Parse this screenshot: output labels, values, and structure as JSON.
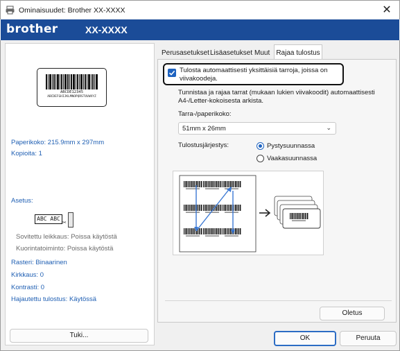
{
  "window": {
    "title": "Ominaisuudet: Brother XX-XXXX"
  },
  "brand": {
    "logo": "brother",
    "model": "XX-XXXX"
  },
  "left_panel": {
    "preview": {
      "code_text": "ABCDE12345",
      "code_sub": "ABCDEFGHIJKLMNOPQRSTUVWXYZ"
    },
    "paper_size": "Paperikoko: 215.9mm x 297mm",
    "copies": "Kopioita: 1",
    "layout": "Asetus:",
    "cut_illustration_text": "ABC ABC",
    "smart_cut": "Sovitettu leikkaus: Poissa käytöstä",
    "chain_print": "Kuorintatoiminto: Poissa käytöstä",
    "halftone": "Rasteri: Binaarinen",
    "brightness": "Kirkkaus:    0",
    "contrast": "Kontrasti:    0",
    "distributed_print": "Hajautettu tulostus: Käytössä",
    "support_button": "Tuki..."
  },
  "tabs": [
    {
      "label": "Perusasetukset"
    },
    {
      "label": "Lisäasetukset"
    },
    {
      "label": "Muut"
    },
    {
      "label": "Rajaa tulostus"
    }
  ],
  "crop_print": {
    "checkbox_label": "Tulosta automaattisesti yksittäisiä tarroja, joissa on viivakoodeja.",
    "checkbox_checked": true,
    "description": "Tunnistaa ja rajaa tarrat (mukaan lukien viivakoodit) automaattisesti A4-/Letter-kokoisesta arkista.",
    "size_label": "Tarra-/paperikoko:",
    "size_value": "51mm x 26mm",
    "order_label": "Tulostusjärjestys:",
    "order_options": [
      {
        "label": "Pystysuunnassa",
        "selected": true
      },
      {
        "label": "Vaakasuunnassa",
        "selected": false
      }
    ],
    "defaults_button": "Oletus"
  },
  "footer": {
    "ok_button": "OK",
    "cancel_button": "Peruuta"
  },
  "colors": {
    "brand_bar": "#1b4c98",
    "accent": "#1e63c0",
    "info_text": "#1f5fb3"
  }
}
